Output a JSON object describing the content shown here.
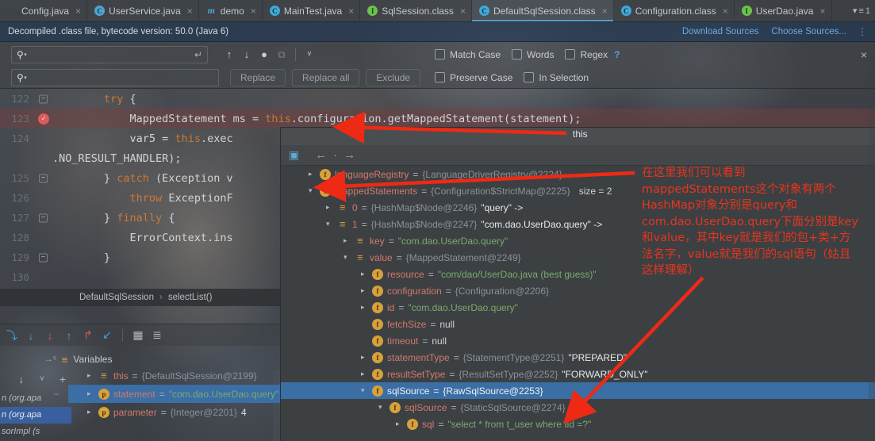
{
  "tabs": [
    {
      "label": "Config.java",
      "icon": "class-file-icon-none",
      "icon_kind": "none",
      "active": false,
      "close": "×"
    },
    {
      "label": "UserService.java",
      "icon": "java-class-icon",
      "icon_kind": "c",
      "active": false,
      "close": "×"
    },
    {
      "label": "demo",
      "icon": "maven-module-icon",
      "icon_kind": "m",
      "active": false,
      "close": "×"
    },
    {
      "label": "MainTest.java",
      "icon": "java-class-icon",
      "icon_kind": "cb",
      "active": false,
      "close": "×"
    },
    {
      "label": "SqlSession.class",
      "icon": "java-interface-icon",
      "icon_kind": "i",
      "active": false,
      "close": "×"
    },
    {
      "label": "DefaultSqlSession.class",
      "icon": "java-class-icon",
      "icon_kind": "cb",
      "active": true,
      "close": "×"
    },
    {
      "label": "Configuration.class",
      "icon": "java-class-icon",
      "icon_kind": "cb",
      "active": false,
      "close": "×"
    },
    {
      "label": "UserDao.java",
      "icon": "java-interface-icon",
      "icon_kind": "i",
      "active": false,
      "close": "×"
    }
  ],
  "tab_overflow": {
    "caret": "▾",
    "lines": "≡",
    "count": "1"
  },
  "notification": {
    "message": "Decompiled .class file, bytecode version: 50.0 (Java 6)",
    "download_sources": "Download Sources",
    "choose_sources": "Choose Sources...",
    "gear": "⋮"
  },
  "find": {
    "search_icon": "⚲",
    "caret": "▾",
    "search_value": "",
    "search_placeholder": "",
    "enter_icon": "↵",
    "replace_value": "",
    "replace_placeholder": "",
    "prev_icon": "↑",
    "next_icon": "↓",
    "select_all_icon": "●",
    "open_in_find_icon": "⧉",
    "filter_icon": "ᵛ",
    "replace_label": "Replace",
    "replace_all_label": "Replace all",
    "exclude_label": "Exclude",
    "match_case": "Match Case",
    "words": "Words",
    "regex": "Regex",
    "help": "?",
    "preserve_case": "Preserve Case",
    "in_selection": "In Selection",
    "close_icon": "×"
  },
  "editor": {
    "lines": [
      {
        "num": "122",
        "code": "        try {",
        "fold": "−",
        "highlight": false,
        "breakpoint": false
      },
      {
        "num": "123",
        "code": "            MappedStatement ms = this.configuration.getMappedStatement(statement);",
        "fold": "",
        "highlight": true,
        "breakpoint": true,
        "bp_icon": "breakpoint-checked"
      },
      {
        "num": "124",
        "code": "            var5 = this.exec",
        "fold": "",
        "highlight": false,
        "breakpoint": false
      },
      {
        "num": "",
        "code": ".NO_RESULT_HANDLER);",
        "fold": "",
        "highlight": false,
        "breakpoint": false,
        "no_indent": true
      },
      {
        "num": "125",
        "code": "        } catch (Exception v",
        "fold": "−",
        "highlight": false,
        "breakpoint": false
      },
      {
        "num": "126",
        "code": "            throw ExceptionF",
        "fold": "",
        "highlight": false,
        "breakpoint": false
      },
      {
        "num": "127",
        "code": "        } finally {",
        "fold": "−",
        "highlight": false,
        "breakpoint": false
      },
      {
        "num": "128",
        "code": "            ErrorContext.ins",
        "fold": "",
        "highlight": false,
        "breakpoint": false
      },
      {
        "num": "129",
        "code": "        }",
        "fold": "−",
        "highlight": false,
        "breakpoint": false
      },
      {
        "num": "130",
        "code": "",
        "fold": "",
        "highlight": false,
        "breakpoint": false
      }
    ],
    "breadcrumb": {
      "class": "DefaultSqlSession",
      "sep": "›",
      "method": "selectList()"
    }
  },
  "debugger": {
    "toolbar_icons": [
      {
        "name": "step-over-icon",
        "glyph": "⤵",
        "color": "#4a9bd1"
      },
      {
        "name": "step-into-icon",
        "glyph": "↓",
        "color": "#4a9bd1"
      },
      {
        "name": "force-step-into-icon",
        "glyph": "↓",
        "color": "#d15a5a"
      },
      {
        "name": "step-out-icon",
        "glyph": "↑",
        "color": "#4a9bd1"
      },
      {
        "name": "drop-frame-icon",
        "glyph": "↱",
        "color": "#d15a5a"
      },
      {
        "name": "run-to-cursor-icon",
        "glyph": "↙",
        "color": "#4a9bd1"
      },
      {
        "name": "evaluate-expression-icon",
        "glyph": "▦",
        "color": "#b6babe"
      },
      {
        "name": "settings-icon",
        "glyph": "≣",
        "color": "#b6babe"
      }
    ],
    "variables_tab": {
      "label": "Variables",
      "icon": "≡",
      "arrow_icon": "→ˢ"
    },
    "left_tools": [
      {
        "name": "mute-breakpoints-icon",
        "glyph": "↓"
      },
      {
        "name": "filter-icon",
        "glyph": "ᵛ"
      },
      {
        "name": "add-watch-icon",
        "glyph": "+"
      },
      {
        "name": "remove-watch-icon",
        "glyph": "−"
      },
      {
        "name": "move-up-icon",
        "glyph": "▲"
      }
    ],
    "frames": [
      {
        "label": "n (org.apa",
        "selected": false
      },
      {
        "label": "n (org.apa",
        "selected": true
      },
      {
        "label": "sorImpl (s",
        "selected": false
      }
    ],
    "variables": [
      {
        "arrow": "▸",
        "icon": "list",
        "icon_glyph": "≡",
        "name": "this",
        "eq": "=",
        "ref": "{DefaultSqlSession@2199}",
        "value": "",
        "value_kind": "",
        "selected": false
      },
      {
        "arrow": "▸",
        "icon": "param",
        "icon_glyph": "p",
        "name": "statement",
        "eq": "=",
        "ref": "",
        "value": "\"com.dao.UserDao.query\"",
        "value_kind": "string",
        "selected": true
      },
      {
        "arrow": "▸",
        "icon": "param",
        "icon_glyph": "p",
        "name": "parameter",
        "eq": "=",
        "ref": "{Integer@2201}",
        "value": "4",
        "value_kind": "num",
        "selected": false
      }
    ]
  },
  "popup": {
    "toolbar": [
      {
        "name": "set-value-icon",
        "glyph": "▣"
      },
      {
        "name": "back-icon",
        "glyph": "←"
      },
      {
        "name": "dot-icon",
        "glyph": "·"
      },
      {
        "name": "forward-icon",
        "glyph": "→"
      }
    ],
    "tree": [
      {
        "indent": 30,
        "arrow": "▸",
        "icon": "f",
        "name": "languageRegistry",
        "eq": "=",
        "ref": "{LanguageDriverRegistry@2224}",
        "value": "",
        "value_kind": "",
        "extra": "",
        "selected": false
      },
      {
        "indent": 30,
        "arrow": "▾",
        "icon": "f",
        "name": "mappedStatements",
        "eq": "=",
        "ref": "{Configuration$StrictMap@2225}",
        "value": "",
        "value_kind": "",
        "extra": "size = 2",
        "selected": false
      },
      {
        "indent": 52,
        "arrow": "▸",
        "icon": "list",
        "name": "0",
        "eq": "=",
        "ref": "{HashMap$Node@2246}",
        "value": "\"query\" ->",
        "value_kind": "bold",
        "extra": "",
        "selected": false
      },
      {
        "indent": 52,
        "arrow": "▾",
        "icon": "list",
        "name": "1",
        "eq": "=",
        "ref": "{HashMap$Node@2247}",
        "value": "\"com.dao.UserDao.query\" ->",
        "value_kind": "bold",
        "extra": "",
        "selected": false
      },
      {
        "indent": 74,
        "arrow": "▸",
        "icon": "list",
        "name": "key",
        "eq": "=",
        "ref": "",
        "value": "\"com.dao.UserDao.query\"",
        "value_kind": "string",
        "extra": "",
        "selected": false
      },
      {
        "indent": 74,
        "arrow": "▾",
        "icon": "list",
        "name": "value",
        "eq": "=",
        "ref": "{MappedStatement@2249}",
        "value": "",
        "value_kind": "",
        "extra": "",
        "selected": false
      },
      {
        "indent": 96,
        "arrow": "▸",
        "icon": "f",
        "name": "resource",
        "eq": "=",
        "ref": "",
        "value": "\"com/dao/UserDao.java (best guess)\"",
        "value_kind": "string",
        "extra": "",
        "selected": false
      },
      {
        "indent": 96,
        "arrow": "▸",
        "icon": "f",
        "name": "configuration",
        "eq": "=",
        "ref": "{Configuration@2206}",
        "value": "",
        "value_kind": "",
        "extra": "",
        "selected": false
      },
      {
        "indent": 96,
        "arrow": "▸",
        "icon": "f",
        "name": "id",
        "eq": "=",
        "ref": "",
        "value": "\"com.dao.UserDao.query\"",
        "value_kind": "string",
        "extra": "",
        "selected": false
      },
      {
        "indent": 96,
        "arrow": "",
        "icon": "f",
        "name": "fetchSize",
        "eq": "=",
        "ref": "",
        "value": "null",
        "value_kind": "plain",
        "extra": "",
        "selected": false
      },
      {
        "indent": 96,
        "arrow": "",
        "icon": "f",
        "name": "timeout",
        "eq": "=",
        "ref": "",
        "value": "null",
        "value_kind": "plain",
        "extra": "",
        "selected": false
      },
      {
        "indent": 96,
        "arrow": "▸",
        "icon": "f",
        "name": "statementType",
        "eq": "=",
        "ref": "{StatementType@2251}",
        "value": "\"PREPARED\"",
        "value_kind": "bold",
        "extra": "",
        "selected": false
      },
      {
        "indent": 96,
        "arrow": "▸",
        "icon": "f",
        "name": "resultSetType",
        "eq": "=",
        "ref": "{ResultSetType@2252}",
        "value": "\"FORWARD_ONLY\"",
        "value_kind": "bold",
        "extra": "",
        "selected": false
      },
      {
        "indent": 96,
        "arrow": "▾",
        "icon": "f",
        "name": "sqlSource",
        "eq": "=",
        "ref": "{RawSqlSource@2253}",
        "value": "",
        "value_kind": "",
        "extra": "",
        "selected": true
      },
      {
        "indent": 118,
        "arrow": "▾",
        "icon": "f",
        "name": "sqlSource",
        "eq": "=",
        "ref": "{StaticSqlSource@2274}",
        "value": "",
        "value_kind": "",
        "extra": "",
        "selected": false
      },
      {
        "indent": 140,
        "arrow": "▸",
        "icon": "f",
        "name": "sql",
        "eq": "=",
        "ref": "",
        "value": "\"select * from t_user where tid =?\"",
        "value_kind": "string",
        "extra": "",
        "selected": false
      }
    ]
  },
  "annotation": {
    "color": "#e8341c",
    "code_label": "this",
    "text": "在这里我们可以看到\nmappedStatements这个对象有两个\nHashMap对象分别是query和\ncom.dao.UserDao.query下面分别是key\n和value，其中key就是我们的包+类+方\n法名字，value就是我们的sql语句（姑且\n这样理解）"
  }
}
